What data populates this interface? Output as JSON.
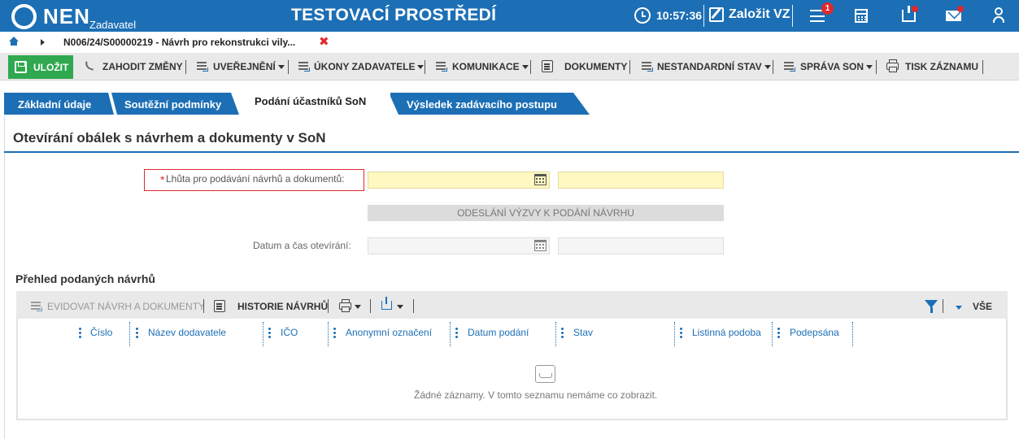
{
  "header": {
    "brand": "NEN",
    "brand_sub": "Zadavatel",
    "env_title": "TESTOVACÍ PROSTŘEDÍ",
    "time": "10:57:36",
    "create_label": "Založit VZ",
    "notif_count": "1",
    "icons": [
      "clock-icon",
      "edit-icon",
      "menu-icon",
      "calculator-icon",
      "inbox-icon",
      "mail-icon",
      "user-icon"
    ],
    "accent": "#1c6fb5",
    "alert_color": "#e0282e"
  },
  "breadcrumb": {
    "text": "N006/24/S00000219 - Návrh pro rekonstrukci vily...",
    "close_glyph": "✖"
  },
  "toolbar": {
    "save": "ULOŽIT",
    "discard": "ZAHODIT ZMĚNY",
    "publish": "UVEŘEJNĚNÍ",
    "actions": "ÚKONY ZADAVATELE",
    "communication": "KOMUNIKACE",
    "documents": "DOKUMENTY",
    "nonstandard": "NESTANDARDNÍ STAV",
    "manage": "SPRÁVA SON",
    "print": "TISK ZÁZNAMU",
    "save_color": "#2fa84f"
  },
  "tabs": [
    {
      "label": "Základní údaje"
    },
    {
      "label": "Soutěžní podmínky"
    },
    {
      "label": "Podání účastníků SoN"
    },
    {
      "label": "Výsledek zadávacího postupu"
    }
  ],
  "section": {
    "title": "Otevírání obálek s návrhem a dokumenty v SoN"
  },
  "form": {
    "deadline_label": "Lhůta pro podávání návrhů a dokumentů:",
    "required_mark": "*",
    "deadline_date": "",
    "deadline_time": "",
    "send_button": "ODESLÁNÍ VÝZVY K PODÁNÍ NÁVRHU",
    "opening_label": "Datum a čas otevírání:",
    "opening_date": "",
    "opening_time": ""
  },
  "grid": {
    "title": "Přehled podaných návrhů",
    "register": "EVIDOVAT NÁVRH A DOKUMENTY",
    "history": "HISTORIE NÁVRHŮ",
    "all": "VŠE",
    "columns": [
      "Číslo",
      "Název dodavatele",
      "IČO",
      "Anonymní označení",
      "Datum podání",
      "Stav",
      "Listinná podoba",
      "Podepsána"
    ],
    "empty": "Žádné záznamy. V tomto seznamu nemáme co zobrazit."
  }
}
